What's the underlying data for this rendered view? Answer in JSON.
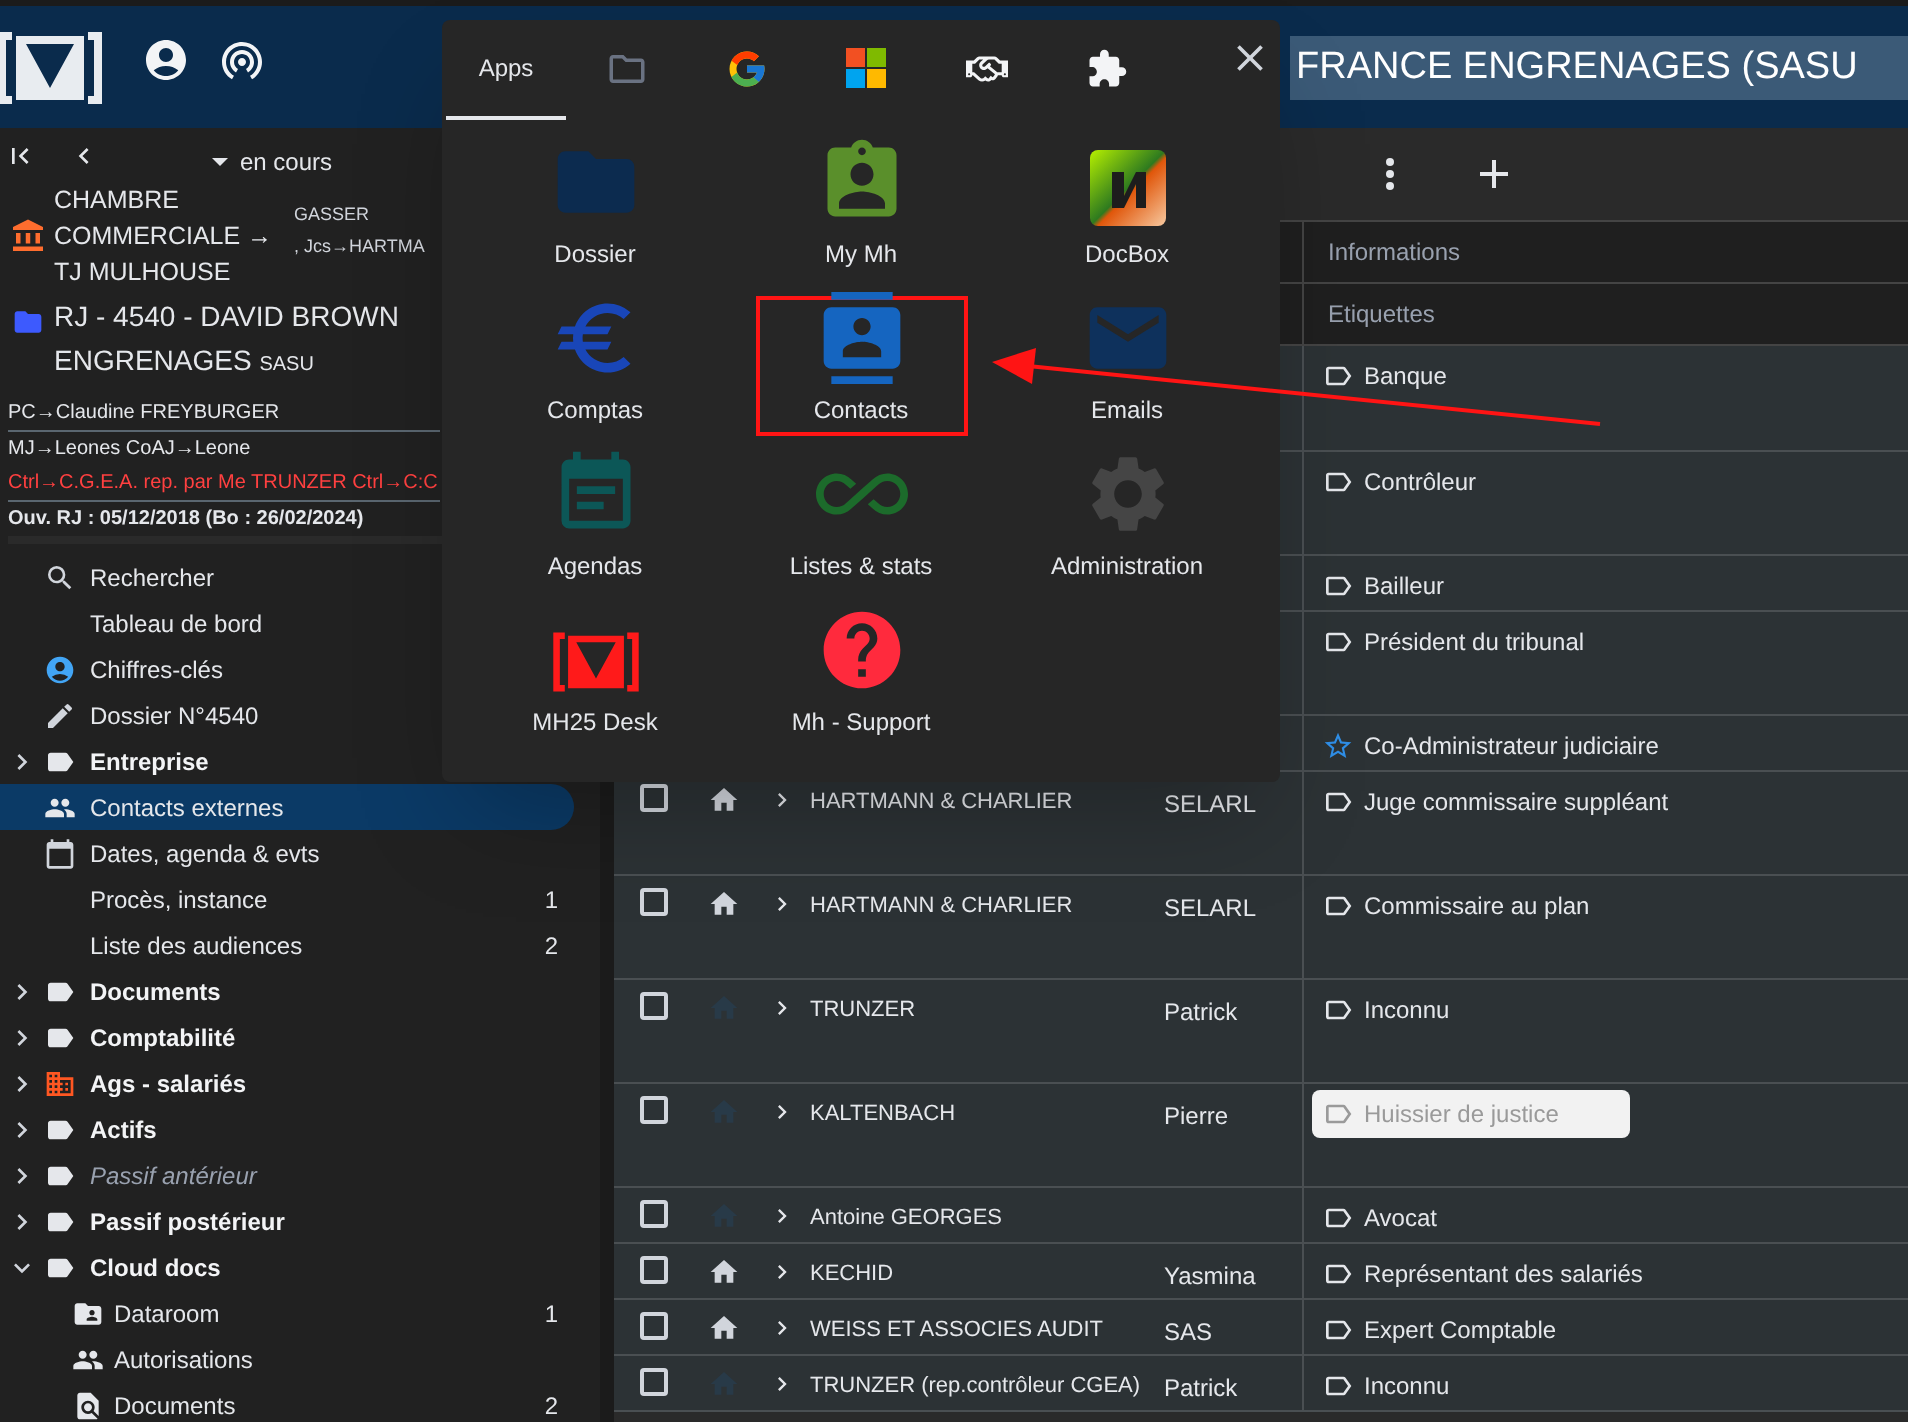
{
  "header": {
    "title": "FRANCE ENGRENAGES (SASU"
  },
  "sidebar": {
    "status": "en cours",
    "court": {
      "name": "CHAMBRE COMMERCIALE → TJ MULHOUSE",
      "judge": "GASSER",
      "jcs": ", Jcs→HARTMA"
    },
    "case": {
      "title": "RJ - 4540 - DAVID BROWN ENGRENAGES",
      "form": "SASU"
    },
    "parties": [
      {
        "text": "PC→Claudine FREYBURGER",
        "kind": "normal"
      },
      {
        "text": "MJ→Leones   CoAJ→Leone",
        "kind": "normal"
      },
      {
        "text": "Ctrl→C.G.E.A. rep. par Me TRUNZER   Ctrl→C:C",
        "kind": "alert"
      }
    ],
    "opening": "Ouv. RJ : 05/12/2018 (Bo : 26/02/2024)",
    "items": [
      {
        "label": "Rechercher",
        "kind": "link",
        "selected": false
      },
      {
        "label": "Tableau de bord",
        "kind": "link",
        "selected": false
      },
      {
        "label": "Chiffres-clés",
        "kind": "link",
        "selected": false
      },
      {
        "label": "Dossier N°4540",
        "kind": "link",
        "selected": false
      },
      {
        "label": "Entreprise",
        "kind": "group",
        "expanded": false,
        "empty": false,
        "selected": false
      },
      {
        "label": "Contacts externes",
        "kind": "link",
        "selected": true
      },
      {
        "label": "Dates, agenda & evts",
        "kind": "link",
        "selected": false
      },
      {
        "label": "Procès, instance",
        "kind": "link",
        "count": "1",
        "selected": false
      },
      {
        "label": "Liste des audiences",
        "kind": "link",
        "count": "2",
        "selected": false
      },
      {
        "label": "Documents",
        "kind": "group",
        "expanded": false,
        "empty": false,
        "selected": false
      },
      {
        "label": "Comptabilité",
        "kind": "group",
        "expanded": false,
        "empty": false,
        "selected": false
      },
      {
        "label": "Ags - salariés",
        "kind": "group",
        "expanded": false,
        "empty": false,
        "selected": false
      },
      {
        "label": "Actifs",
        "kind": "group",
        "expanded": false,
        "empty": false,
        "selected": false
      },
      {
        "label": "Passif antérieur",
        "kind": "group",
        "expanded": false,
        "empty": true,
        "selected": false
      },
      {
        "label": "Passif postérieur",
        "kind": "group",
        "expanded": false,
        "empty": false,
        "selected": false
      },
      {
        "label": "Cloud docs",
        "kind": "group",
        "expanded": true,
        "empty": false,
        "selected": false,
        "children": [
          {
            "label": "Dataroom",
            "count": "1",
            "selected": false
          },
          {
            "label": "Autorisations",
            "selected": false
          },
          {
            "label": "Documents",
            "count": "2",
            "selected": false
          }
        ]
      }
    ]
  },
  "table": {
    "columns": [
      "Informations",
      "Etiquettes"
    ],
    "rows": [
      {
        "tag": {
          "label": "Banque",
          "kind": "tag",
          "highlighted": false
        }
      },
      {
        "tag": {
          "label": "Contrôleur",
          "kind": "tag",
          "highlighted": false
        }
      },
      {
        "tag": {
          "label": "Bailleur",
          "kind": "tag",
          "highlighted": false
        }
      },
      {
        "tag": {
          "label": "Président du tribunal",
          "kind": "tag",
          "highlighted": false
        }
      },
      {
        "tag": {
          "label": "Co-Administrateur judiciaire",
          "kind": "star",
          "highlighted": false
        }
      },
      {
        "checked": false,
        "name": "HARTMANN & CHARLIER",
        "first": "SELARL",
        "primary": true,
        "tag": {
          "label": "Juge commissaire suppléant",
          "kind": "tag",
          "highlighted": false
        }
      },
      {
        "checked": false,
        "name": "HARTMANN & CHARLIER",
        "first": "SELARL",
        "primary": true,
        "tag": {
          "label": "Commissaire au plan",
          "kind": "tag",
          "highlighted": false
        }
      },
      {
        "checked": false,
        "name": "TRUNZER",
        "first": "Patrick",
        "primary": false,
        "tag": {
          "label": "Inconnu",
          "kind": "tag",
          "highlighted": false
        }
      },
      {
        "checked": false,
        "name": "KALTENBACH",
        "first": "Pierre",
        "primary": false,
        "tag": {
          "label": "Huissier de justice",
          "kind": "tag",
          "highlighted": true
        }
      },
      {
        "checked": false,
        "name": "Antoine GEORGES",
        "primary": false,
        "tag": {
          "label": "Avocat",
          "kind": "tag",
          "highlighted": false
        }
      },
      {
        "checked": false,
        "name": "KECHID",
        "first": "Yasmina",
        "primary": true,
        "tag": {
          "label": "Représentant des salariés",
          "kind": "tag",
          "highlighted": false
        }
      },
      {
        "checked": false,
        "name": "WEISS ET ASSOCIES AUDIT",
        "first": "SAS",
        "primary": true,
        "tag": {
          "label": "Expert Comptable",
          "kind": "tag",
          "highlighted": false
        }
      },
      {
        "checked": false,
        "name": "TRUNZER (rep.contrôleur CGEA)",
        "first": "Patrick",
        "primary": false,
        "tag": {
          "label": "Inconnu",
          "kind": "tag",
          "highlighted": false
        }
      }
    ]
  },
  "apps_menu": {
    "tabs": [
      {
        "label": "Apps",
        "selected": true
      },
      {
        "selected": false
      },
      {
        "selected": false
      },
      {
        "selected": false
      },
      {
        "selected": false
      },
      {
        "selected": false
      }
    ],
    "apps": [
      {
        "label": "Dossier",
        "highlighted": false
      },
      {
        "label": "My Mh",
        "highlighted": false
      },
      {
        "label": "DocBox",
        "highlighted": false
      },
      {
        "label": "Comptas",
        "highlighted": false
      },
      {
        "label": "Contacts",
        "highlighted": true
      },
      {
        "label": "Emails",
        "highlighted": false
      },
      {
        "label": "Agendas",
        "highlighted": false
      },
      {
        "label": "Listes & stats",
        "highlighted": false
      },
      {
        "label": "Administration",
        "highlighted": false
      },
      {
        "label": "MH25 Desk",
        "highlighted": false
      },
      {
        "label": "Mh - Support",
        "highlighted": false
      }
    ]
  }
}
